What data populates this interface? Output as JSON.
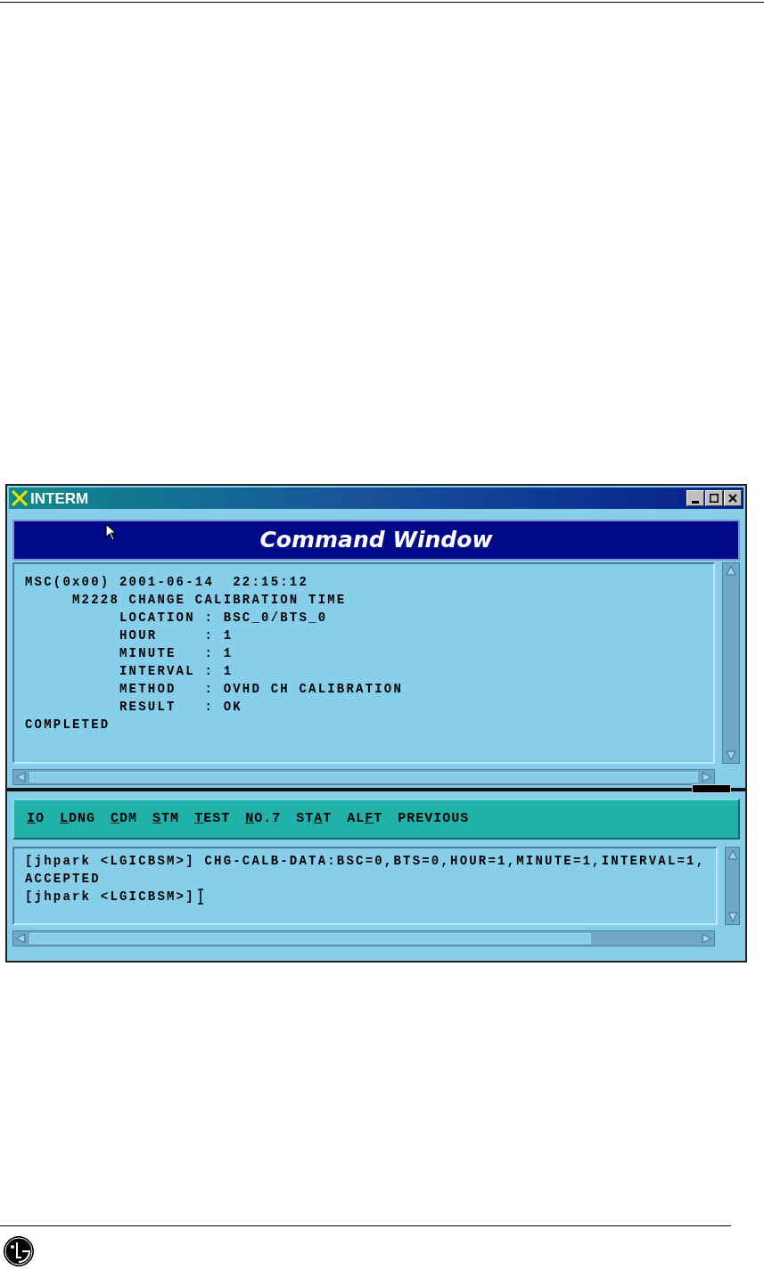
{
  "window": {
    "title": "INTERM",
    "header": "Command Window"
  },
  "output": {
    "lines": [
      "MSC(0x00) 2001-06-14  22:15:12",
      "     M2228 CHANGE CALIBRATION TIME",
      "          LOCATION : BSC_0/BTS_0",
      "          HOUR     : 1",
      "          MINUTE   : 1",
      "          INTERVAL : 1",
      "          METHOD   : OVHD CH CALIBRATION",
      "          RESULT   : OK",
      "COMPLETED"
    ]
  },
  "menu": [
    {
      "key": "I",
      "after": "O"
    },
    {
      "key": "L",
      "after": "DNG"
    },
    {
      "key": "C",
      "after": "DM"
    },
    {
      "key": "S",
      "after": "TM"
    },
    {
      "key": "T",
      "after": "EST"
    },
    {
      "key": "N",
      "after": "O.7"
    },
    {
      "before": "ST",
      "key": "A",
      "after": "T"
    },
    {
      "before": "AL",
      "key": "F",
      "after": "T"
    },
    {
      "before": "PREVIOUS"
    }
  ],
  "console": {
    "lines": [
      "[jhpark <LGICBSM>] CHG-CALB-DATA:BSC=0,BTS=0,HOUR=1,MINUTE=1,INTERVAL=1,",
      "ACCEPTED",
      "[jhpark <LGICBSM>]"
    ]
  }
}
